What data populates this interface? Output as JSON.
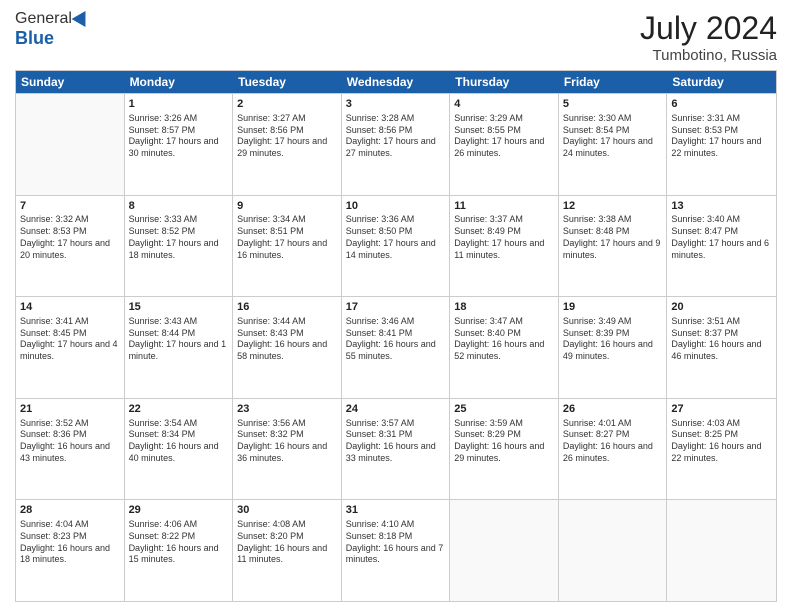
{
  "logo": {
    "general": "General",
    "blue": "Blue"
  },
  "header": {
    "month_year": "July 2024",
    "location": "Tumbotino, Russia"
  },
  "days": [
    "Sunday",
    "Monday",
    "Tuesday",
    "Wednesday",
    "Thursday",
    "Friday",
    "Saturday"
  ],
  "weeks": [
    [
      {
        "num": "",
        "sunrise": "",
        "sunset": "",
        "daylight": ""
      },
      {
        "num": "1",
        "sunrise": "Sunrise: 3:26 AM",
        "sunset": "Sunset: 8:57 PM",
        "daylight": "Daylight: 17 hours and 30 minutes."
      },
      {
        "num": "2",
        "sunrise": "Sunrise: 3:27 AM",
        "sunset": "Sunset: 8:56 PM",
        "daylight": "Daylight: 17 hours and 29 minutes."
      },
      {
        "num": "3",
        "sunrise": "Sunrise: 3:28 AM",
        "sunset": "Sunset: 8:56 PM",
        "daylight": "Daylight: 17 hours and 27 minutes."
      },
      {
        "num": "4",
        "sunrise": "Sunrise: 3:29 AM",
        "sunset": "Sunset: 8:55 PM",
        "daylight": "Daylight: 17 hours and 26 minutes."
      },
      {
        "num": "5",
        "sunrise": "Sunrise: 3:30 AM",
        "sunset": "Sunset: 8:54 PM",
        "daylight": "Daylight: 17 hours and 24 minutes."
      },
      {
        "num": "6",
        "sunrise": "Sunrise: 3:31 AM",
        "sunset": "Sunset: 8:53 PM",
        "daylight": "Daylight: 17 hours and 22 minutes."
      }
    ],
    [
      {
        "num": "7",
        "sunrise": "Sunrise: 3:32 AM",
        "sunset": "Sunset: 8:53 PM",
        "daylight": "Daylight: 17 hours and 20 minutes."
      },
      {
        "num": "8",
        "sunrise": "Sunrise: 3:33 AM",
        "sunset": "Sunset: 8:52 PM",
        "daylight": "Daylight: 17 hours and 18 minutes."
      },
      {
        "num": "9",
        "sunrise": "Sunrise: 3:34 AM",
        "sunset": "Sunset: 8:51 PM",
        "daylight": "Daylight: 17 hours and 16 minutes."
      },
      {
        "num": "10",
        "sunrise": "Sunrise: 3:36 AM",
        "sunset": "Sunset: 8:50 PM",
        "daylight": "Daylight: 17 hours and 14 minutes."
      },
      {
        "num": "11",
        "sunrise": "Sunrise: 3:37 AM",
        "sunset": "Sunset: 8:49 PM",
        "daylight": "Daylight: 17 hours and 11 minutes."
      },
      {
        "num": "12",
        "sunrise": "Sunrise: 3:38 AM",
        "sunset": "Sunset: 8:48 PM",
        "daylight": "Daylight: 17 hours and 9 minutes."
      },
      {
        "num": "13",
        "sunrise": "Sunrise: 3:40 AM",
        "sunset": "Sunset: 8:47 PM",
        "daylight": "Daylight: 17 hours and 6 minutes."
      }
    ],
    [
      {
        "num": "14",
        "sunrise": "Sunrise: 3:41 AM",
        "sunset": "Sunset: 8:45 PM",
        "daylight": "Daylight: 17 hours and 4 minutes."
      },
      {
        "num": "15",
        "sunrise": "Sunrise: 3:43 AM",
        "sunset": "Sunset: 8:44 PM",
        "daylight": "Daylight: 17 hours and 1 minute."
      },
      {
        "num": "16",
        "sunrise": "Sunrise: 3:44 AM",
        "sunset": "Sunset: 8:43 PM",
        "daylight": "Daylight: 16 hours and 58 minutes."
      },
      {
        "num": "17",
        "sunrise": "Sunrise: 3:46 AM",
        "sunset": "Sunset: 8:41 PM",
        "daylight": "Daylight: 16 hours and 55 minutes."
      },
      {
        "num": "18",
        "sunrise": "Sunrise: 3:47 AM",
        "sunset": "Sunset: 8:40 PM",
        "daylight": "Daylight: 16 hours and 52 minutes."
      },
      {
        "num": "19",
        "sunrise": "Sunrise: 3:49 AM",
        "sunset": "Sunset: 8:39 PM",
        "daylight": "Daylight: 16 hours and 49 minutes."
      },
      {
        "num": "20",
        "sunrise": "Sunrise: 3:51 AM",
        "sunset": "Sunset: 8:37 PM",
        "daylight": "Daylight: 16 hours and 46 minutes."
      }
    ],
    [
      {
        "num": "21",
        "sunrise": "Sunrise: 3:52 AM",
        "sunset": "Sunset: 8:36 PM",
        "daylight": "Daylight: 16 hours and 43 minutes."
      },
      {
        "num": "22",
        "sunrise": "Sunrise: 3:54 AM",
        "sunset": "Sunset: 8:34 PM",
        "daylight": "Daylight: 16 hours and 40 minutes."
      },
      {
        "num": "23",
        "sunrise": "Sunrise: 3:56 AM",
        "sunset": "Sunset: 8:32 PM",
        "daylight": "Daylight: 16 hours and 36 minutes."
      },
      {
        "num": "24",
        "sunrise": "Sunrise: 3:57 AM",
        "sunset": "Sunset: 8:31 PM",
        "daylight": "Daylight: 16 hours and 33 minutes."
      },
      {
        "num": "25",
        "sunrise": "Sunrise: 3:59 AM",
        "sunset": "Sunset: 8:29 PM",
        "daylight": "Daylight: 16 hours and 29 minutes."
      },
      {
        "num": "26",
        "sunrise": "Sunrise: 4:01 AM",
        "sunset": "Sunset: 8:27 PM",
        "daylight": "Daylight: 16 hours and 26 minutes."
      },
      {
        "num": "27",
        "sunrise": "Sunrise: 4:03 AM",
        "sunset": "Sunset: 8:25 PM",
        "daylight": "Daylight: 16 hours and 22 minutes."
      }
    ],
    [
      {
        "num": "28",
        "sunrise": "Sunrise: 4:04 AM",
        "sunset": "Sunset: 8:23 PM",
        "daylight": "Daylight: 16 hours and 18 minutes."
      },
      {
        "num": "29",
        "sunrise": "Sunrise: 4:06 AM",
        "sunset": "Sunset: 8:22 PM",
        "daylight": "Daylight: 16 hours and 15 minutes."
      },
      {
        "num": "30",
        "sunrise": "Sunrise: 4:08 AM",
        "sunset": "Sunset: 8:20 PM",
        "daylight": "Daylight: 16 hours and 11 minutes."
      },
      {
        "num": "31",
        "sunrise": "Sunrise: 4:10 AM",
        "sunset": "Sunset: 8:18 PM",
        "daylight": "Daylight: 16 hours and 7 minutes."
      },
      {
        "num": "",
        "sunrise": "",
        "sunset": "",
        "daylight": ""
      },
      {
        "num": "",
        "sunrise": "",
        "sunset": "",
        "daylight": ""
      },
      {
        "num": "",
        "sunrise": "",
        "sunset": "",
        "daylight": ""
      }
    ]
  ]
}
